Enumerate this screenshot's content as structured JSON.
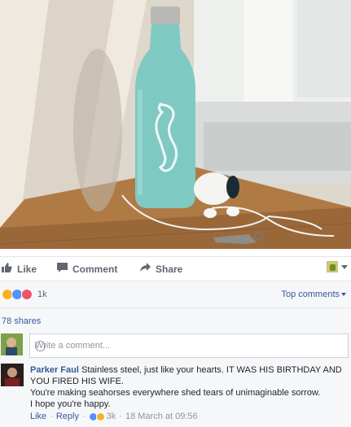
{
  "post": {
    "photo_alt": "",
    "actions": {
      "like_label": "Like",
      "comment_label": "Comment",
      "share_label": "Share"
    },
    "reactions": {
      "types": [
        "haha",
        "like",
        "love"
      ],
      "count": "1k"
    },
    "top_comments_label": "Top comments",
    "shares_label": "78 shares"
  },
  "composer": {
    "placeholder": "Write a comment..."
  },
  "comment": {
    "author": "Parker Faul",
    "lines": [
      "Stainless steel, just like your hearts. IT WAS HIS BIRTHDAY AND YOU FIRED HIS WIFE.",
      "You're making seahorses everywhere shed tears of unimaginable sorrow.",
      "I hope you're happy."
    ],
    "like_label": "Like",
    "reply_label": "Reply",
    "reaction_count": "3k",
    "timestamp": "18 March at 09:56"
  },
  "colors": {
    "link": "#385898",
    "bottle": "#7fc9c3",
    "like_blue": "#5890ff",
    "love_red": "#f25268",
    "haha_yellow": "#f7b125"
  }
}
